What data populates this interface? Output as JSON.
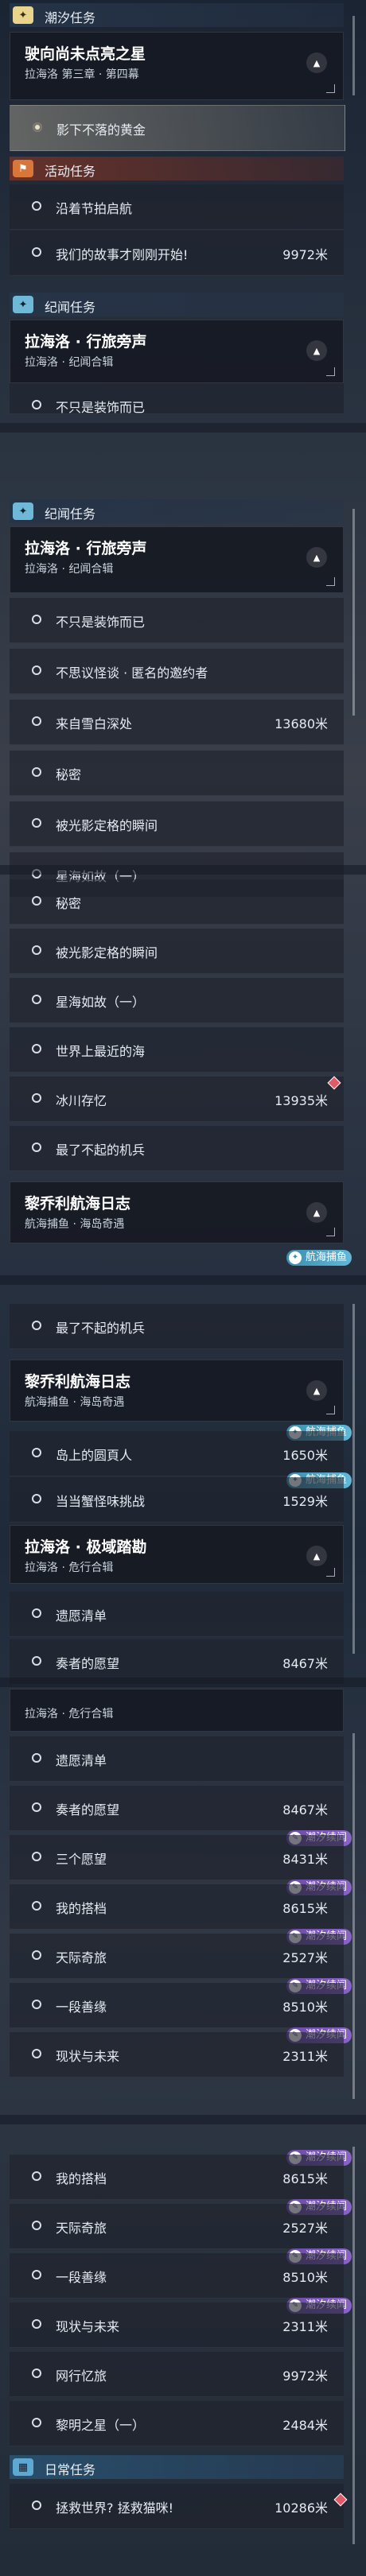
{
  "tide_header": "潮汐任务",
  "tide_card": {
    "title": "驶向尚未点亮之星",
    "subtitle": "拉海洛 第三章 · 第四幕"
  },
  "tide_selected": "影下不落的黄金",
  "activity_header": "活动任务",
  "activity_items": [
    {
      "label": "沿着节拍启航",
      "dist": ""
    },
    {
      "label": "我们的故事才刚刚开始!",
      "dist": "9972米"
    }
  ],
  "annal_header": "纪闻任务",
  "annal_card_a": {
    "title": "拉海洛 · 行旅旁声",
    "subtitle": "拉海洛 · 纪闻合辑"
  },
  "annal_partial": "不只是装饰而已",
  "annal_list_1": [
    {
      "label": "不只是装饰而已",
      "dist": ""
    },
    {
      "label": "不思议怪谈 · 匿名的邀约者",
      "dist": ""
    },
    {
      "label": "来自雪白深处",
      "dist": "13680米"
    },
    {
      "label": "秘密",
      "dist": ""
    },
    {
      "label": "被光影定格的瞬间",
      "dist": ""
    },
    {
      "label": "星海如故（一）",
      "dist": ""
    }
  ],
  "annal_list_2": [
    {
      "label": "秘密",
      "dist": ""
    },
    {
      "label": "被光影定格的瞬间",
      "dist": ""
    },
    {
      "label": "星海如故（一）",
      "dist": ""
    },
    {
      "label": "世界上最近的海",
      "dist": ""
    },
    {
      "label": "冰川存忆",
      "dist": "13935米"
    },
    {
      "label": "最了不起的机兵",
      "dist": ""
    }
  ],
  "card_b": {
    "title": "黎乔利航海日志",
    "subtitle": "航海捕鱼 · 海岛奇遇"
  },
  "tag_sea": "航海捕鱼",
  "list_3": [
    {
      "label": "最了不起的机兵",
      "dist": ""
    }
  ],
  "list_4": [
    {
      "label": "岛上的圆頁人",
      "dist": "1650米"
    },
    {
      "label": "当当蟹怪味挑战",
      "dist": "1529米"
    }
  ],
  "card_c": {
    "title": "拉海洛 · 极域踏勘",
    "subtitle": "拉海洛 · 危行合辑"
  },
  "list_5": [
    {
      "label": "遗愿清单",
      "dist": ""
    },
    {
      "label": "奏者的愿望",
      "dist": "8467米"
    }
  ],
  "card_c_partial": "拉海洛 · 极域踏勘",
  "list_6": [
    {
      "label": "遗愿清单",
      "dist": ""
    },
    {
      "label": "奏者的愿望",
      "dist": "8467米"
    },
    {
      "label": "三个愿望",
      "dist": "8431米"
    },
    {
      "label": "我的搭档",
      "dist": "8615米"
    },
    {
      "label": "天际奇旅",
      "dist": "2527米"
    },
    {
      "label": "一段善缘",
      "dist": "8510米"
    },
    {
      "label": "现状与未来",
      "dist": "2311米"
    }
  ],
  "tag_tide": "潮汐续闻",
  "list_7": [
    {
      "label": "我的搭档",
      "dist": "8615米"
    },
    {
      "label": "天际奇旅",
      "dist": "2527米"
    },
    {
      "label": "一段善缘",
      "dist": "8510米"
    },
    {
      "label": "现状与未来",
      "dist": "2311米"
    },
    {
      "label": "网行忆旅",
      "dist": "9972米"
    },
    {
      "label": "黎明之星（一）",
      "dist": "2484米"
    }
  ],
  "daily_header": "日常任务",
  "daily_items": [
    {
      "label": "拯救世界? 拯救猫咪!",
      "dist": "10286米"
    }
  ],
  "icons": {
    "tide": "sparkle-icon",
    "activity": "event-icon",
    "annal": "sparkle-icon",
    "daily": "calendar-icon"
  }
}
